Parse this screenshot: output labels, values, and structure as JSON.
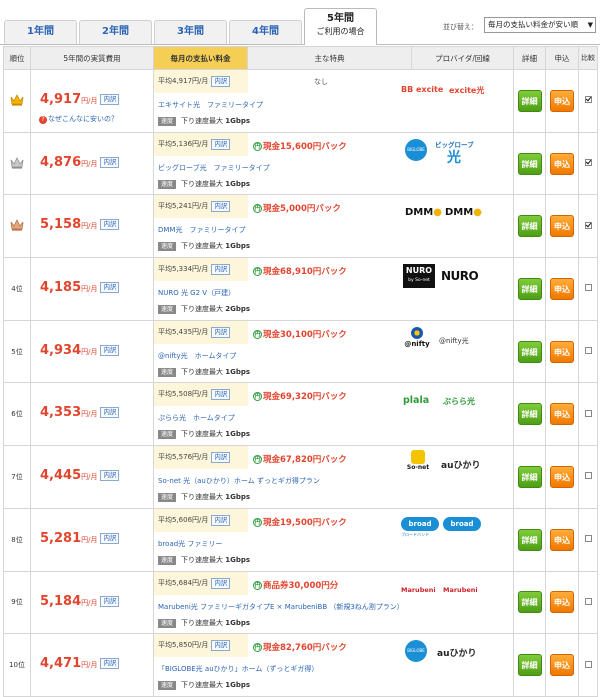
{
  "tabs": [
    {
      "label": "1年間",
      "active": false
    },
    {
      "label": "2年間",
      "active": false
    },
    {
      "label": "3年間",
      "active": false
    },
    {
      "label": "4年間",
      "active": false
    },
    {
      "label": "5年間",
      "sub": "ご利用の場合",
      "active": true
    }
  ],
  "sort": {
    "label": "並び替え：",
    "selected": "毎月の支払い料金が安い順",
    "arrow": "▼"
  },
  "headers": {
    "rank": "順位",
    "cost": "5年間の実質費用",
    "fee": "毎月の支払い料金",
    "perk": "主な特典",
    "provider": "プロバイダ/回線",
    "detail": "詳細",
    "apply": "申込",
    "compare": "比較"
  },
  "labels": {
    "detail_inline": "内訳",
    "speed_tag": "速度",
    "speed_prefix": "下り速度最大",
    "detail_btn": "詳細",
    "apply_btn": "申込",
    "cost_unit": "円/月",
    "fee_prefix": "平均",
    "fee_unit": "円/月",
    "perk_icon": "円",
    "note": "なぜこんなに安いの？"
  },
  "rows": [
    {
      "rank": "",
      "crown": "gold",
      "cost": "4,917",
      "fee": "4,917",
      "perk": "なし",
      "perk_none": true,
      "plan": "エキサイト光　ファミリータイプ",
      "speed": "1Gbps",
      "logo": "excite",
      "checked": true,
      "note": true
    },
    {
      "rank": "",
      "crown": "silver",
      "cost": "4,876",
      "fee": "5,136",
      "perk": "現金15,600円バック",
      "plan": "ビッグローブ光　ファミリータイプ",
      "speed": "1Gbps",
      "logo": "biglobe",
      "checked": true
    },
    {
      "rank": "",
      "crown": "bronze",
      "cost": "5,158",
      "fee": "5,241",
      "perk": "現金5,000円バック",
      "plan": "DMM光　ファミリータイプ",
      "speed": "1Gbps",
      "logo": "dmm",
      "checked": true
    },
    {
      "rank": "4位",
      "cost": "4,185",
      "fee": "5,334",
      "perk": "現金68,910円バック",
      "plan": "NURO 光 G2 V（戸建）",
      "speed": "2Gbps",
      "logo": "nuro",
      "checked": false
    },
    {
      "rank": "5位",
      "cost": "4,934",
      "fee": "5,435",
      "perk": "現金30,100円バック",
      "plan": "@nifty光　ホームタイプ",
      "speed": "1Gbps",
      "logo": "nifty",
      "checked": false
    },
    {
      "rank": "6位",
      "cost": "4,353",
      "fee": "5,508",
      "perk": "現金69,320円バック",
      "plan": "ぷらら光　ホームタイプ",
      "speed": "1Gbps",
      "logo": "plala",
      "checked": false
    },
    {
      "rank": "7位",
      "cost": "4,445",
      "fee": "5,576",
      "perk": "現金67,820円バック",
      "plan": "So-net 光（auひかり）ホーム ずっとギガ得プラン",
      "speed": "1Gbps",
      "logo": "sonet",
      "checked": false
    },
    {
      "rank": "8位",
      "cost": "5,281",
      "fee": "5,606",
      "perk": "現金19,500円バック",
      "plan": "broad光 ファミリー",
      "speed": "1Gbps",
      "logo": "broad",
      "checked": false
    },
    {
      "rank": "9位",
      "cost": "5,184",
      "fee": "5,684",
      "perk": "商品券30,000円分",
      "plan": "Marubeni光 ファミリーギガタイプE × MarubeniBB （新規3ねん割プラン）",
      "speed": "1Gbps",
      "logo": "marubeni",
      "checked": false
    },
    {
      "rank": "10位",
      "cost": "4,471",
      "fee": "5,850",
      "perk": "現金82,760円バック",
      "plan": "「BIGLOBE光 auひかり」ホーム（ずっとギガ得）",
      "speed": "1Gbps",
      "logo": "biglobe-au",
      "checked": false
    }
  ],
  "logo_text": {
    "excite_a": "BB excite",
    "excite_b": "excite光",
    "biglobe_a": "BIGLOBE",
    "biglobe_b": "ビッグローブ",
    "biglobe_c": "光",
    "dmm_a": "DMM",
    "dmm_b": "DMM",
    "nuro_a": "NURO",
    "nuro_b": "by So-net",
    "nuro_c": "NURO",
    "nifty_a": "@nifty",
    "nifty_b": "@nifty光",
    "plala_a": "plala",
    "plala_b": "ぷらら光",
    "sonet_a": "So-net",
    "sonet_b": "auひかり",
    "broad_a": "broad",
    "broad_b": "broad",
    "broad_sub": "ブロードバンド",
    "marubeni_a": "Marubeni",
    "marubeni_b": "Marubeni",
    "bigau_a": "BIGLOBE",
    "bigau_b": "auひかり"
  },
  "colors": {
    "price_red": "#e2452f",
    "link_blue": "#2a64b4",
    "fee_bg": "#fdf6da",
    "header_hl": "#f5cf55",
    "detail_green": "#5aaa1e",
    "apply_orange": "#f58a00"
  }
}
